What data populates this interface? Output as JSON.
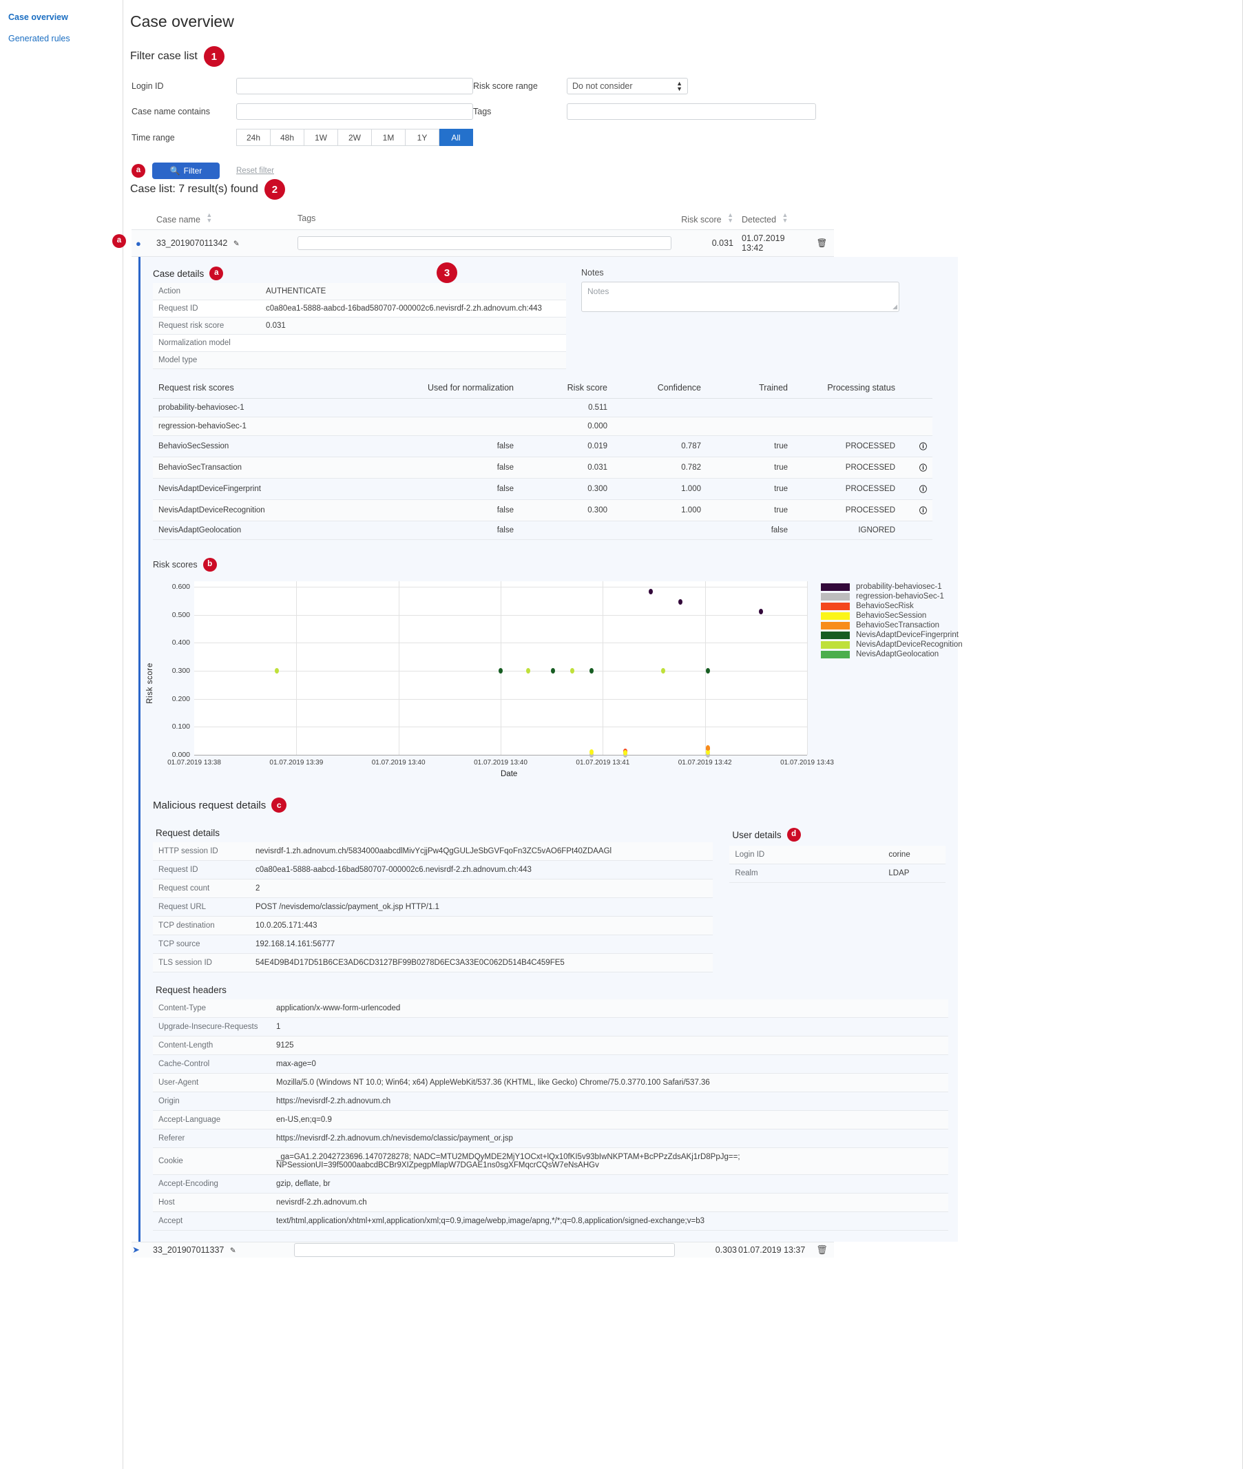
{
  "sidebar": {
    "items": [
      {
        "label": "Case overview"
      },
      {
        "label": "Generated rules"
      }
    ]
  },
  "header": {
    "title": "Case overview"
  },
  "filter": {
    "title": "Filter case list",
    "step_badge": "1",
    "action_badge": "a",
    "login_id_label": "Login ID",
    "login_id_value": "",
    "case_name_label": "Case name contains",
    "case_name_value": "",
    "time_range_label": "Time range",
    "time_ranges": [
      "24h",
      "48h",
      "1W",
      "2W",
      "1M",
      "1Y",
      "All"
    ],
    "time_range_selected": "All",
    "risk_score_range_label": "Risk score range",
    "risk_score_range_value": "Do not consider",
    "tags_label": "Tags",
    "tags_value": "",
    "filter_button": "Filter",
    "filter_icon": "search-icon",
    "reset_link": "Reset filter"
  },
  "caselist": {
    "heading": "Case list: 7 result(s) found",
    "step_badge": "2",
    "row_badge": "a",
    "columns": [
      "Case name",
      "Tags",
      "Risk score",
      "Detected"
    ],
    "rows": [
      {
        "expanded": true,
        "name": "33_201907011342",
        "tags": "",
        "risk_score": "0.031",
        "detected": "01.07.2019 13:42"
      },
      {
        "expanded": false,
        "name": "33_201907011337",
        "tags": "",
        "risk_score": "0.303",
        "detected": "01.07.2019 13:37"
      }
    ]
  },
  "details": {
    "step_badge": "3",
    "case_details": {
      "title": "Case details",
      "badge": "a",
      "rows": [
        {
          "k": "Action",
          "v": "AUTHENTICATE"
        },
        {
          "k": "Request ID",
          "v": "c0a80ea1-5888-aabcd-16bad580707-000002c6.nevisrdf-2.zh.adnovum.ch:443"
        },
        {
          "k": "Request risk score",
          "v": "0.031"
        },
        {
          "k": "Normalization model",
          "v": ""
        },
        {
          "k": "Model type",
          "v": ""
        }
      ]
    },
    "notes": {
      "label": "Notes",
      "placeholder": "Notes",
      "value": ""
    },
    "risk_scores_table": {
      "columns": [
        "Request risk scores",
        "Used for normalization",
        "Risk score",
        "Confidence",
        "Trained",
        "Processing status",
        ""
      ],
      "rows": [
        {
          "name": "probability-behaviosec-1",
          "norm": "",
          "risk": "0.511",
          "conf": "",
          "trained": "",
          "status": "",
          "info": false
        },
        {
          "name": "regression-behavioSec-1",
          "norm": "",
          "risk": "0.000",
          "conf": "",
          "trained": "",
          "status": "",
          "info": false
        },
        {
          "name": "BehavioSecSession",
          "norm": "false",
          "risk": "0.019",
          "conf": "0.787",
          "trained": "true",
          "status": "PROCESSED",
          "info": true
        },
        {
          "name": "BehavioSecTransaction",
          "norm": "false",
          "risk": "0.031",
          "conf": "0.782",
          "trained": "true",
          "status": "PROCESSED",
          "info": true
        },
        {
          "name": "NevisAdaptDeviceFingerprint",
          "norm": "false",
          "risk": "0.300",
          "conf": "1.000",
          "trained": "true",
          "status": "PROCESSED",
          "info": true
        },
        {
          "name": "NevisAdaptDeviceRecognition",
          "norm": "false",
          "risk": "0.300",
          "conf": "1.000",
          "trained": "true",
          "status": "PROCESSED",
          "info": true
        },
        {
          "name": "NevisAdaptGeolocation",
          "norm": "false",
          "risk": "",
          "conf": "",
          "trained": "false",
          "status": "IGNORED",
          "info": false
        }
      ]
    },
    "chart_badge": "b",
    "malicious": {
      "title": "Malicious request details",
      "badge": "c",
      "request_details_title": "Request details",
      "request_details": [
        {
          "k": "HTTP session ID",
          "v": "nevisrdf-1.zh.adnovum.ch/5834000aabcdlMivYcjjPw4QgGULJeSbGVFqoFn3ZC5vAO6FPt40ZDAAGl"
        },
        {
          "k": "Request ID",
          "v": "c0a80ea1-5888-aabcd-16bad580707-000002c6.nevisrdf-2.zh.adnovum.ch:443"
        },
        {
          "k": "Request count",
          "v": "2"
        },
        {
          "k": "Request URL",
          "v": "POST /nevisdemo/classic/payment_ok.jsp HTTP/1.1"
        },
        {
          "k": "TCP destination",
          "v": "10.0.205.171:443"
        },
        {
          "k": "TCP source",
          "v": "192.168.14.161:56777"
        },
        {
          "k": "TLS session ID",
          "v": "54E4D9B4D17D51B6CE3AD6CD3127BF99B0278D6EC3A33E0C062D514B4C459FE5"
        }
      ],
      "user_details_title": "User details",
      "user_badge": "d",
      "user_details": [
        {
          "k": "Login ID",
          "v": "corine"
        },
        {
          "k": "Realm",
          "v": "LDAP"
        }
      ],
      "request_headers_title": "Request headers",
      "request_headers": [
        {
          "k": "Content-Type",
          "v": "application/x-www-form-urlencoded"
        },
        {
          "k": "Upgrade-Insecure-Requests",
          "v": "1"
        },
        {
          "k": "Content-Length",
          "v": "9125"
        },
        {
          "k": "Cache-Control",
          "v": "max-age=0"
        },
        {
          "k": "User-Agent",
          "v": "Mozilla/5.0 (Windows NT 10.0; Win64; x64) AppleWebKit/537.36 (KHTML, like Gecko) Chrome/75.0.3770.100 Safari/537.36"
        },
        {
          "k": "Origin",
          "v": "https://nevisrdf-2.zh.adnovum.ch"
        },
        {
          "k": "Accept-Language",
          "v": "en-US,en;q=0.9"
        },
        {
          "k": "Referer",
          "v": "https://nevisrdf-2.zh.adnovum.ch/nevisdemo/classic/payment_or.jsp"
        },
        {
          "k": "Cookie",
          "v": "_ga=GA1.2.2042723696.1470728278; NADC=MTU2MDQyMDE2MjY1OCxt+lQx10fKI5v93bIwNKPTAM+BcPPzZdsAKj1rD8PpJg==; NPSessionUI=39f5000aabcdBCBr9XIZpegpMlapW7DGAE1ns0sgXFMqcrCQsW7eNsAHGv"
        },
        {
          "k": "Accept-Encoding",
          "v": "gzip, deflate, br"
        },
        {
          "k": "Host",
          "v": "nevisrdf-2.zh.adnovum.ch"
        },
        {
          "k": "Accept",
          "v": "text/html,application/xhtml+xml,application/xml;q=0.9,image/webp,image/apng,*/*;q=0.8,application/signed-exchange;v=b3"
        }
      ]
    }
  },
  "chart_data": {
    "type": "scatter",
    "title": "Risk scores",
    "xlabel": "Date",
    "ylabel": "Risk score",
    "ylim": [
      0.0,
      0.62
    ],
    "yticks": [
      "0.000",
      "0.100",
      "0.200",
      "0.300",
      "0.400",
      "0.500",
      "0.600"
    ],
    "ytick_values": [
      0.0,
      0.1,
      0.2,
      0.3,
      0.4,
      0.5,
      0.6
    ],
    "xticks": [
      "01.07.2019 13:38",
      "01.07.2019 13:39",
      "01.07.2019 13:40",
      "01.07.2019 13:40",
      "01.07.2019 13:41",
      "01.07.2019 13:42",
      "01.07.2019 13:43"
    ],
    "xtick_positions": [
      0.0,
      0.1667,
      0.3333,
      0.5,
      0.6667,
      0.8333,
      1.0
    ],
    "grid": true,
    "legend_position": "right",
    "series": [
      {
        "name": "probability-behaviosec-1",
        "color": "#33093a",
        "points": [
          {
            "x": 0.745,
            "y": 0.583
          },
          {
            "x": 0.793,
            "y": 0.547
          },
          {
            "x": 0.925,
            "y": 0.511
          }
        ]
      },
      {
        "name": "regression-behavioSec-1",
        "color": "#bdbdbd",
        "points": [
          {
            "x": 0.648,
            "y": 0.0
          },
          {
            "x": 0.703,
            "y": 0.0
          },
          {
            "x": 0.838,
            "y": 0.0
          }
        ]
      },
      {
        "name": "BehavioSecRisk",
        "color": "#f4471c",
        "points": [
          {
            "x": 0.703,
            "y": 0.012
          },
          {
            "x": 0.838,
            "y": 0.021
          }
        ]
      },
      {
        "name": "BehavioSecSession",
        "color": "#fbf51a",
        "points": [
          {
            "x": 0.648,
            "y": 0.009
          },
          {
            "x": 0.703,
            "y": 0.008
          },
          {
            "x": 0.838,
            "y": 0.011
          }
        ]
      },
      {
        "name": "BehavioSecTransaction",
        "color": "#f78c1b",
        "points": [
          {
            "x": 0.838,
            "y": 0.024
          }
        ]
      },
      {
        "name": "NevisAdaptDeviceFingerprint",
        "color": "#175d22",
        "points": [
          {
            "x": 0.5,
            "y": 0.3
          },
          {
            "x": 0.585,
            "y": 0.3
          },
          {
            "x": 0.648,
            "y": 0.3
          },
          {
            "x": 0.838,
            "y": 0.3
          }
        ]
      },
      {
        "name": "NevisAdaptDeviceRecognition",
        "color": "#bfe03a",
        "points": [
          {
            "x": 0.135,
            "y": 0.3
          },
          {
            "x": 0.545,
            "y": 0.3
          },
          {
            "x": 0.617,
            "y": 0.3
          },
          {
            "x": 0.765,
            "y": 0.3
          }
        ]
      },
      {
        "name": "NevisAdaptGeolocation",
        "color": "#4cae4c",
        "points": []
      }
    ]
  }
}
